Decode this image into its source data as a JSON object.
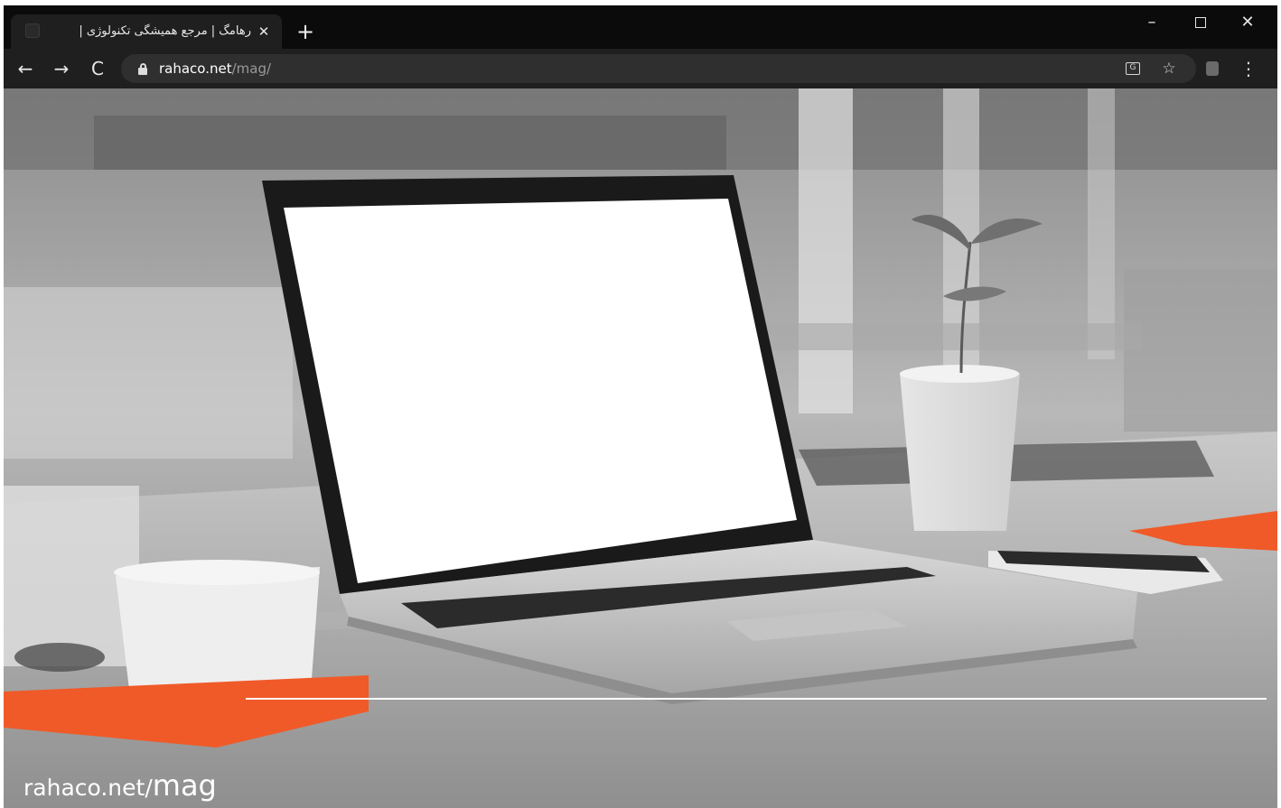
{
  "browser": {
    "tab": {
      "title": "رهامگ | مرجع همیشگی تکنولوژی |",
      "close_label": "✕",
      "favicon_icon": "rahaco-favicon-icon"
    },
    "new_tab_label": "+",
    "window_controls": {
      "minimize": "–",
      "close": "✕"
    },
    "nav": {
      "back": "←",
      "forward": "→",
      "reload": "C"
    },
    "address_bar": {
      "host": "rahaco.net",
      "path": "/mag/"
    },
    "toolbar_icons": {
      "translate": "G",
      "bookmark": "☆",
      "menu": "⋮"
    }
  },
  "page": {
    "caption_domain": "rahaco.net/",
    "caption_mag": "mag",
    "accent_color": "#f05a28",
    "photo_style": "grayscale laptop on desk with orange accent shapes"
  }
}
